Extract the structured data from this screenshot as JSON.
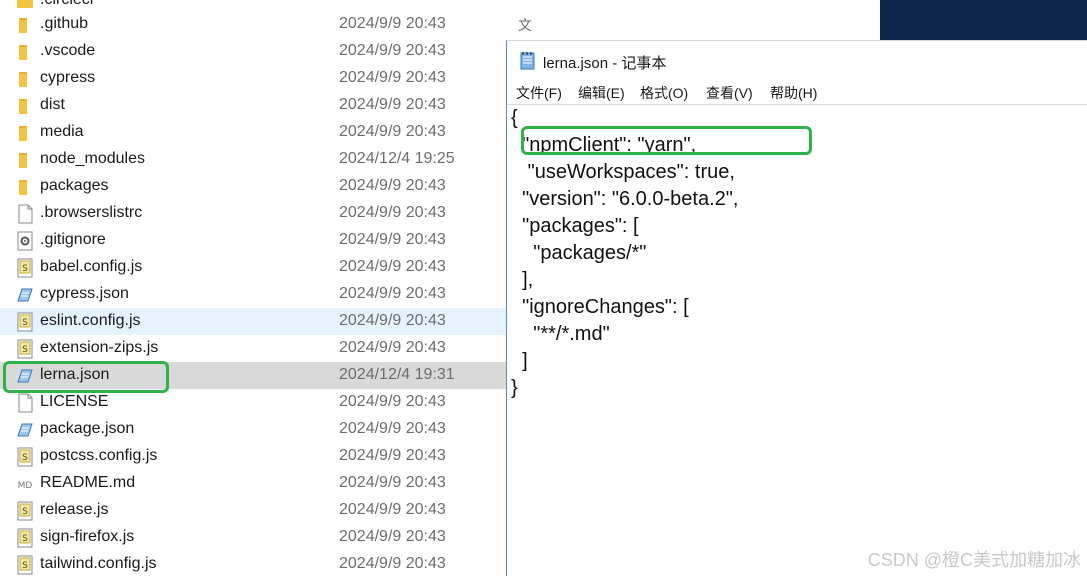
{
  "explorer": {
    "top_partial_name": ".circleci",
    "files": [
      {
        "name": ".github",
        "date": "2024/9/9 20:43",
        "kind": "folder",
        "type": "文"
      },
      {
        "name": ".vscode",
        "date": "2024/9/9 20:43",
        "kind": "folder"
      },
      {
        "name": "cypress",
        "date": "2024/9/9 20:43",
        "kind": "folder"
      },
      {
        "name": "dist",
        "date": "2024/9/9 20:43",
        "kind": "folder"
      },
      {
        "name": "media",
        "date": "2024/9/9 20:43",
        "kind": "folder"
      },
      {
        "name": "node_modules",
        "date": "2024/12/4 19:25",
        "kind": "folder"
      },
      {
        "name": "packages",
        "date": "2024/9/9 20:43",
        "kind": "folder"
      },
      {
        "name": ".browserslistrc",
        "date": "2024/9/9 20:43",
        "kind": "file"
      },
      {
        "name": ".gitignore",
        "date": "2024/9/9 20:43",
        "kind": "settings"
      },
      {
        "name": "babel.config.js",
        "date": "2024/9/9 20:43",
        "kind": "js"
      },
      {
        "name": "cypress.json",
        "date": "2024/9/9 20:43",
        "kind": "json"
      },
      {
        "name": "eslint.config.js",
        "date": "2024/9/9 20:43",
        "kind": "js",
        "state": "hover"
      },
      {
        "name": "extension-zips.js",
        "date": "2024/9/9 20:43",
        "kind": "js"
      },
      {
        "name": "lerna.json",
        "date": "2024/12/4 19:31",
        "kind": "json",
        "state": "selected"
      },
      {
        "name": "LICENSE",
        "date": "2024/9/9 20:43",
        "kind": "file"
      },
      {
        "name": "package.json",
        "date": "2024/9/9 20:43",
        "kind": "json"
      },
      {
        "name": "postcss.config.js",
        "date": "2024/9/9 20:43",
        "kind": "js"
      },
      {
        "name": "README.md",
        "date": "2024/9/9 20:43",
        "kind": "md"
      },
      {
        "name": "release.js",
        "date": "2024/9/9 20:43",
        "kind": "js"
      },
      {
        "name": "sign-firefox.js",
        "date": "2024/9/9 20:43",
        "kind": "js"
      },
      {
        "name": "tailwind.config.js",
        "date": "2024/9/9 20:43",
        "kind": "js"
      }
    ]
  },
  "notepad": {
    "title": "lerna.json - 记事本",
    "menus": [
      "文件(F)",
      "编辑(E)",
      "格式(O)",
      "查看(V)",
      "帮助(H)"
    ],
    "content_lines": [
      "{",
      "  \"npmClient\": \"yarn\",",
      "   \"useWorkspaces\": true,",
      "  \"version\": \"6.0.0-beta.2\",",
      "  \"packages\": [",
      "    \"packages/*\"",
      "  ],",
      "  \"ignoreChanges\": [",
      "    \"**/*.md\"",
      "  ]",
      "}"
    ]
  },
  "watermark": "CSDN @橙C美式加糖加冰",
  "colors": {
    "highlight": "#2db34a",
    "folder": "#f5c342",
    "selected_row": "#d9d9d9",
    "hover_row": "#e5f3ff"
  }
}
